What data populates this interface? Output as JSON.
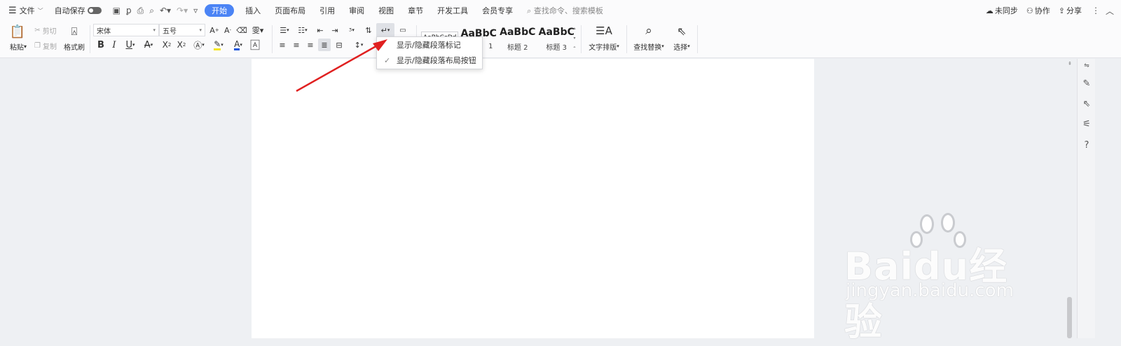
{
  "topbar": {
    "menu_label": "文件",
    "autosave_label": "自动保存",
    "tabs": [
      "开始",
      "插入",
      "页面布局",
      "引用",
      "审阅",
      "视图",
      "章节",
      "开发工具",
      "会员专享"
    ],
    "search_placeholder": "查找命令、搜索模板",
    "right": {
      "sync": "未同步",
      "collab": "协作",
      "share": "分享"
    }
  },
  "ribbon": {
    "paste": "粘贴",
    "cut": "剪切",
    "copy": "复制",
    "format_painter": "格式刷",
    "font_name": "宋体",
    "font_size": "五号",
    "styles": [
      {
        "preview": "AaBbCcDd",
        "label": ""
      },
      {
        "preview": "AaBbC",
        "label": "1"
      },
      {
        "preview": "AaBbC",
        "label": "标题 2"
      },
      {
        "preview": "AaBbC",
        "label": "标题 3"
      }
    ],
    "text_layout": "文字排版",
    "find_replace": "查找替换",
    "select": "选择"
  },
  "dropdown": {
    "items": [
      {
        "label": "显示/隐藏段落标记",
        "checked": false
      },
      {
        "label": "显示/隐藏段落布局按钮",
        "checked": true
      }
    ]
  },
  "watermark": {
    "brand": "Baidu经验",
    "sub": "jingyan.baidu.com"
  },
  "colors": {
    "accent": "#4b84f5",
    "arrow": "#e02020",
    "font_color_underline": "#1a56db",
    "highlight": "#f5e623"
  }
}
